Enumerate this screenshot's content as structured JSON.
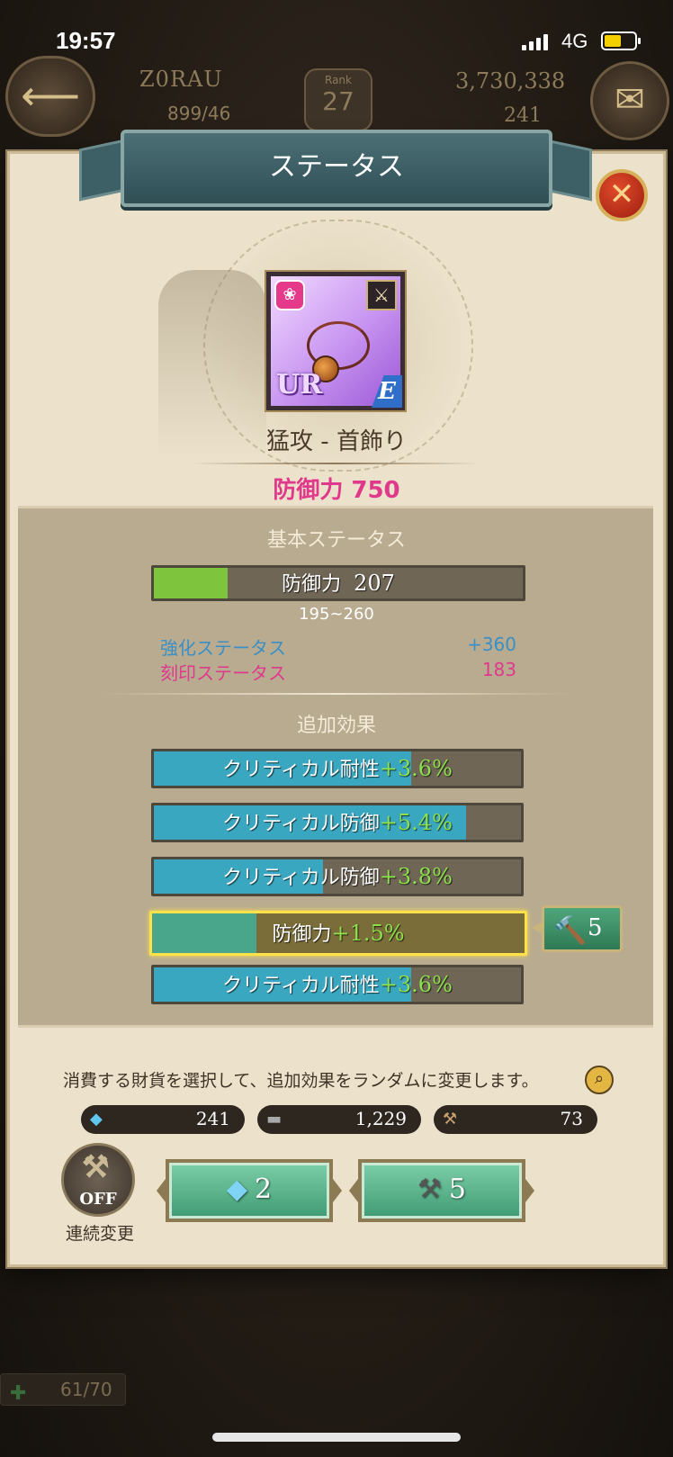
{
  "status_bar": {
    "time": "19:57",
    "network": "4G"
  },
  "hud": {
    "player_name": "Z0RAU",
    "stamina": "899/46",
    "rank_label": "Rank",
    "rank": "27",
    "gold": "3,730,338",
    "gems": "241"
  },
  "modal": {
    "title": "ステータス",
    "item": {
      "rarity": "UR",
      "grade": "E",
      "name": "猛攻 - 首飾り",
      "power": "防御力 750"
    },
    "basic": {
      "title": "基本ステータス",
      "stat_name": "防御力",
      "stat_value": "207",
      "fill_fraction": 0.2,
      "range": "195~260",
      "enhance_label": "強化ステータス",
      "enhance_value": "+360",
      "engrave_label": "刻印ステータス",
      "engrave_value": "183"
    },
    "additional": {
      "title": "追加効果",
      "effects": [
        {
          "name": "クリティカル耐性",
          "value": "+3.6%",
          "fill_fraction": 0.7,
          "selected": false
        },
        {
          "name": "クリティカル防御",
          "value": "+5.4%",
          "fill_fraction": 0.85,
          "selected": false
        },
        {
          "name": "クリティカル防御",
          "value": "+3.8%",
          "fill_fraction": 0.46,
          "selected": false
        },
        {
          "name": "防御力",
          "value": "+1.5%",
          "fill_fraction": 0.28,
          "selected": true
        },
        {
          "name": "クリティカル耐性",
          "value": "+3.6%",
          "fill_fraction": 0.7,
          "selected": false
        }
      ],
      "lock_cost": "5"
    },
    "hint": "消費する財貨を選択して、追加効果をランダムに変更します。",
    "currencies": [
      {
        "icon": "gem-icon",
        "value": "241"
      },
      {
        "icon": "anvil-icon",
        "value": "1,229"
      },
      {
        "icon": "hammer-icon",
        "value": "73"
      }
    ],
    "auto": {
      "state": "OFF",
      "label": "連続変更"
    },
    "actions": [
      {
        "icon": "gem-icon",
        "cost": "2"
      },
      {
        "icon": "anvil-icon",
        "cost": "5"
      }
    ]
  },
  "footer": {
    "count": "61/70"
  },
  "colors": {
    "power_pink": "#e0398c",
    "enhance_blue": "#3b8fc4",
    "value_green": "#8de04c",
    "effect_bar": "#3aa7c0",
    "basic_bar": "#7fc43d",
    "selected_bar": "#4aa68a",
    "highlight": "#ffe14a"
  }
}
